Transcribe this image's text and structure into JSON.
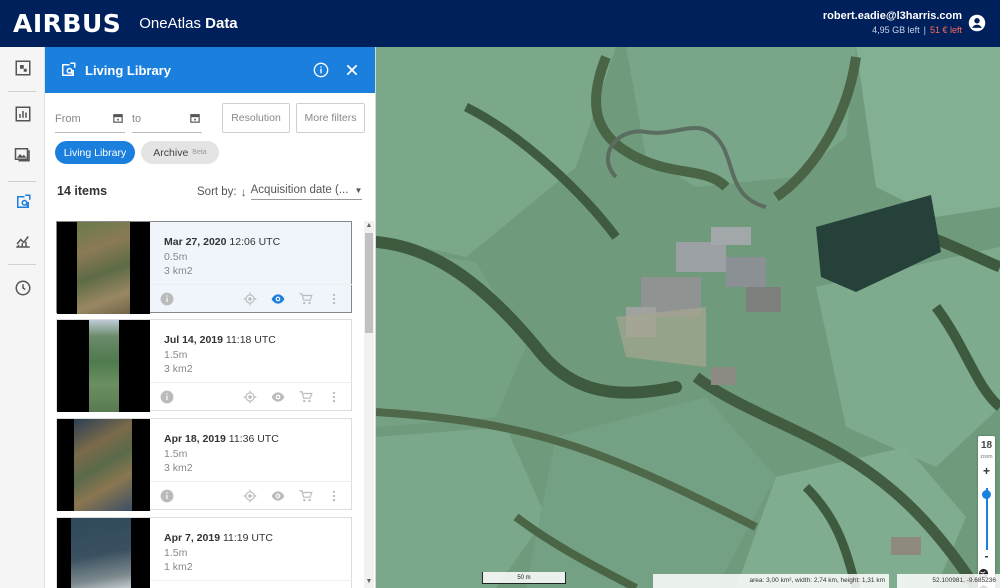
{
  "header": {
    "logo": "AIRBUS",
    "product_light": "OneAtlas",
    "product_bold": "Data",
    "user_email": "robert.eadie@l3harris.com",
    "storage_left": "4,95 GB left",
    "separator": "|",
    "credit_left": "51 € left"
  },
  "rail": {
    "items": [
      "overview-icon",
      "chart-icon",
      "images-icon",
      "living-library-icon",
      "analytics-icon",
      "history-icon"
    ]
  },
  "panel": {
    "title": "Living Library",
    "filters": {
      "from_placeholder": "From",
      "to_placeholder": "to",
      "resolution_label": "Resolution",
      "more_filters_label": "More filters"
    },
    "tabs": {
      "living_library": "Living Library",
      "archive": "Archive",
      "archive_badge": "Beta"
    },
    "count": "14 items",
    "sort_label": "Sort by:",
    "sort_arrow": "↓",
    "sort_value": "Acquisition date (..."
  },
  "items": [
    {
      "date": "Mar 27, 2020",
      "time": "12:06 UTC",
      "resolution": "0.5m",
      "area": "3 km2"
    },
    {
      "date": "Jul 14, 2019",
      "time": "11:18 UTC",
      "resolution": "1.5m",
      "area": "3 km2"
    },
    {
      "date": "Apr 18, 2019",
      "time": "11:36 UTC",
      "resolution": "1.5m",
      "area": "3 km2"
    },
    {
      "date": "Apr 7, 2019",
      "time": "11:19 UTC",
      "resolution": "1.5m",
      "area": "1 km2"
    }
  ],
  "map": {
    "zoom_level": "18",
    "zoom_label": "zoom",
    "zoom_plus": "+",
    "zoom_minus": "-",
    "zoom_fraction": 0.1,
    "scale_label": "50 m",
    "area_info": "area: 3,00 km², width: 2,74 km, height: 1,31 km",
    "coordinates": "52.100981, -9.685236"
  },
  "colors": {
    "topbar": "#00205b",
    "accent": "#1b7fdd",
    "credit": "#ff6b5b"
  }
}
